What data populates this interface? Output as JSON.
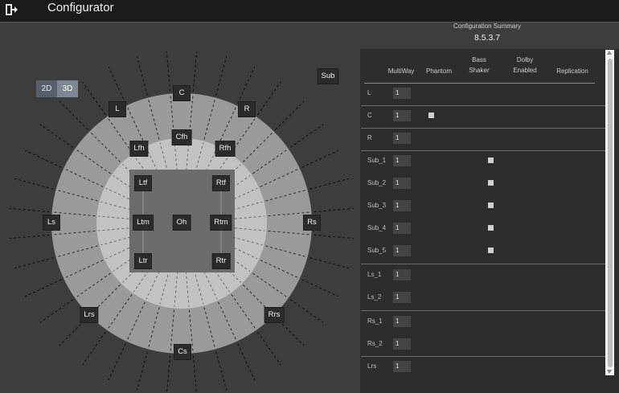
{
  "app": {
    "title": "Configurator",
    "exit_icon": "exit-icon"
  },
  "view_toggle": {
    "options": [
      "2D",
      "3D"
    ],
    "selected": "3D"
  },
  "speakers": [
    "Sub",
    "C",
    "L",
    "R",
    "Cfh",
    "Lfh",
    "Rfh",
    "Ltf",
    "Rtf",
    "Ls",
    "Ltm",
    "Oh",
    "Rtm",
    "Rs",
    "Ltr",
    "Rtr",
    "Lrs",
    "Rrs",
    "Cs"
  ],
  "summary": {
    "title": "Configuration Summary",
    "value": "8.5.3.7"
  },
  "table": {
    "columns": {
      "multiway": "MultiWay",
      "phantom": "Phantom",
      "bass_shaker": "Bass\nShaker",
      "dolby": "Dolby\nEnabled",
      "replication": "Replication"
    },
    "rows": [
      {
        "label": "L",
        "multiway": "1",
        "phantom": false,
        "bass_shaker": false
      },
      {
        "label": "C",
        "multiway": "1",
        "phantom": true,
        "bass_shaker": false
      },
      {
        "label": "R",
        "multiway": "1",
        "phantom": false,
        "bass_shaker": false
      },
      {
        "label": "Sub_1",
        "multiway": "1",
        "phantom": false,
        "bass_shaker": true
      },
      {
        "label": "Sub_2",
        "multiway": "1",
        "phantom": false,
        "bass_shaker": true
      },
      {
        "label": "Sub_3",
        "multiway": "1",
        "phantom": false,
        "bass_shaker": true
      },
      {
        "label": "Sub_4",
        "multiway": "1",
        "phantom": false,
        "bass_shaker": true
      },
      {
        "label": "Sub_5",
        "multiway": "1",
        "phantom": false,
        "bass_shaker": true
      },
      {
        "label": "Ls_1",
        "multiway": "1",
        "phantom": false,
        "bass_shaker": false
      },
      {
        "label": "Ls_2",
        "multiway": "1",
        "phantom": false,
        "bass_shaker": false
      },
      {
        "label": "Rs_1",
        "multiway": "1",
        "phantom": false,
        "bass_shaker": false
      },
      {
        "label": "Rs_2",
        "multiway": "1",
        "phantom": false,
        "bass_shaker": false
      },
      {
        "label": "Lrs",
        "multiway": "1",
        "phantom": false,
        "bass_shaker": false
      }
    ]
  }
}
